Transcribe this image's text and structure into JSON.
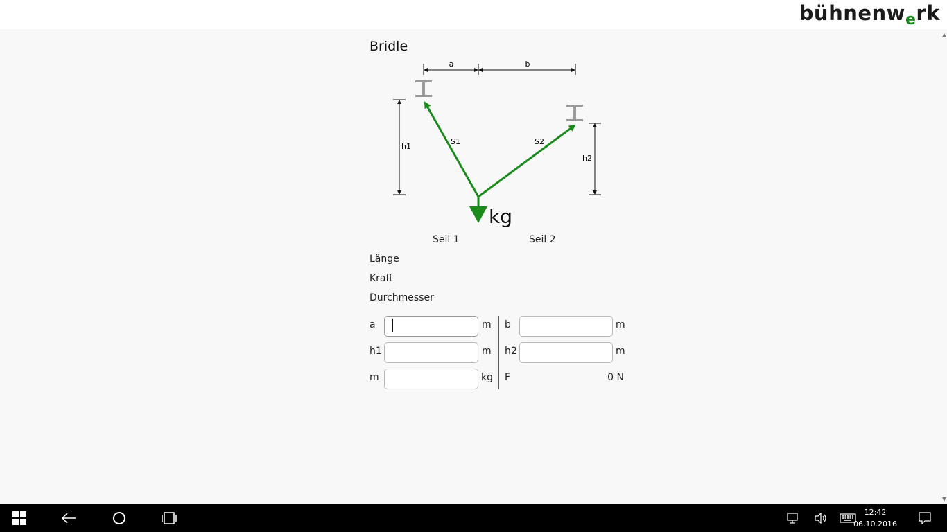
{
  "header": {
    "logo_main": "bühnenw",
    "logo_accent": "e",
    "logo_end": "rk"
  },
  "page": {
    "title": "Bridle"
  },
  "diagram": {
    "dim_a": "a",
    "dim_b": "b",
    "dim_h1": "h1",
    "dim_h2": "h2",
    "rope1": "S1",
    "rope2": "S2",
    "load_unit": "kg",
    "accent_color": "#1a8a1a"
  },
  "results": {
    "col1": "Seil 1",
    "col2": "Seil 2",
    "rows": [
      "Länge",
      "Kraft",
      "Durchmesser"
    ]
  },
  "form": {
    "a": {
      "label": "a",
      "value": "",
      "unit": "m"
    },
    "b": {
      "label": "b",
      "value": "",
      "unit": "m"
    },
    "h1": {
      "label": "h1",
      "value": "",
      "unit": "m"
    },
    "h2": {
      "label": "h2",
      "value": "",
      "unit": "m"
    },
    "m": {
      "label": "m",
      "value": "",
      "unit": "kg"
    },
    "F": {
      "label": "F",
      "value": "0 N"
    }
  },
  "taskbar": {
    "time": "12:42",
    "date": "06.10.2016"
  }
}
